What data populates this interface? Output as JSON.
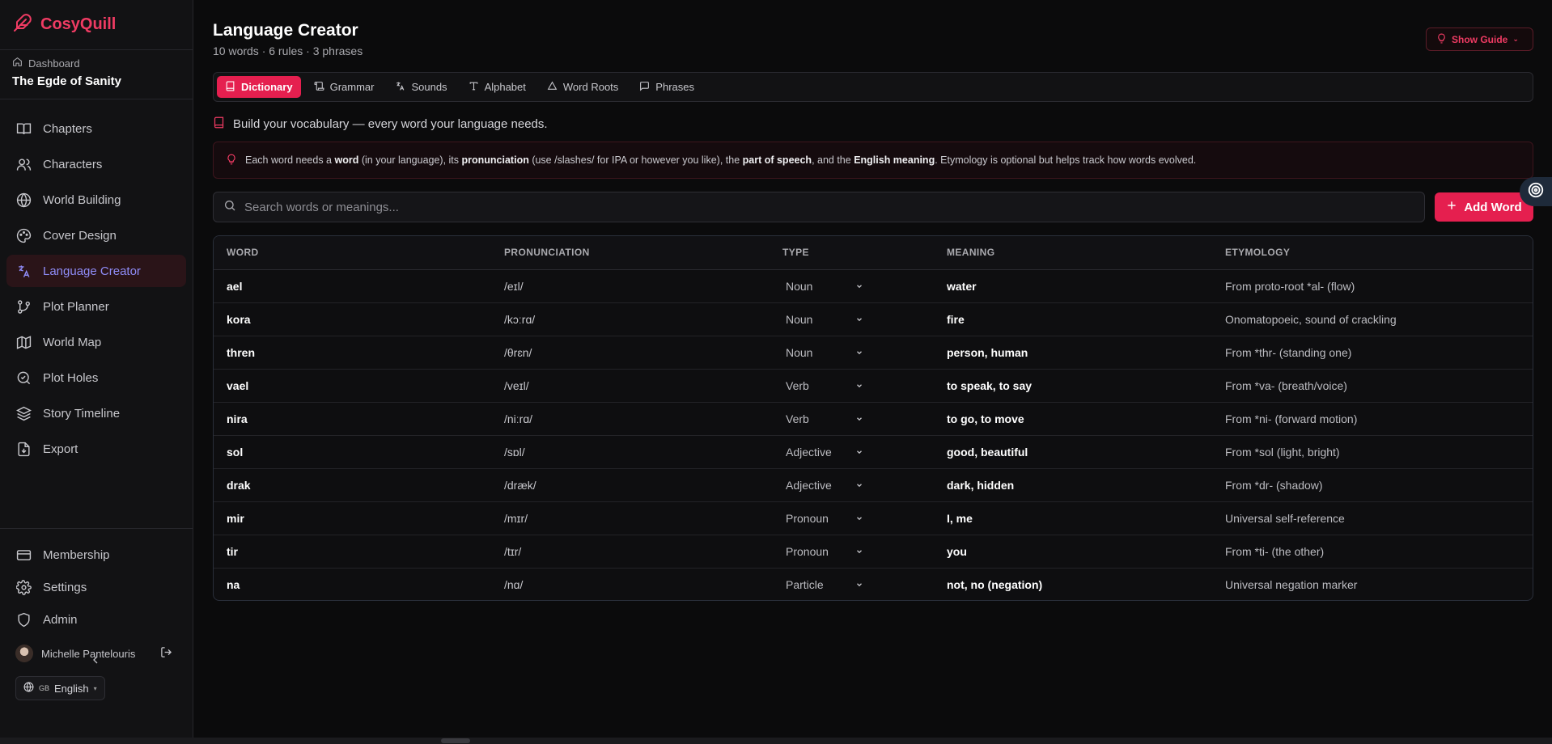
{
  "app": {
    "name": "CosyQuill",
    "accent": "#ef3b63"
  },
  "sidebar": {
    "dashboard_label": "Dashboard",
    "project_title": "The Egde of Sanity",
    "items": [
      {
        "label": "Chapters",
        "icon": "book-open-icon"
      },
      {
        "label": "Characters",
        "icon": "users-icon"
      },
      {
        "label": "World Building",
        "icon": "globe-icon"
      },
      {
        "label": "Cover Design",
        "icon": "palette-icon"
      },
      {
        "label": "Language Creator",
        "icon": "languages-icon",
        "active": true
      },
      {
        "label": "Plot Planner",
        "icon": "git-branch-icon"
      },
      {
        "label": "World Map",
        "icon": "map-icon"
      },
      {
        "label": "Plot Holes",
        "icon": "check-circle-icon"
      },
      {
        "label": "Story Timeline",
        "icon": "layers-icon"
      },
      {
        "label": "Export",
        "icon": "file-download-icon"
      }
    ],
    "bottom_items": [
      {
        "label": "Membership",
        "icon": "credit-card-icon"
      },
      {
        "label": "Settings",
        "icon": "gear-icon"
      },
      {
        "label": "Admin",
        "icon": "shield-icon"
      }
    ],
    "user_name": "Michelle Pantelouris",
    "language_flag": "GB",
    "language_label": "English"
  },
  "header": {
    "title": "Language Creator",
    "subtitle": "10 words · 6 rules · 3 phrases",
    "guide_button": "Show Guide"
  },
  "tabs": [
    {
      "label": "Dictionary",
      "icon": "book-icon",
      "active": true
    },
    {
      "label": "Grammar",
      "icon": "scroll-icon"
    },
    {
      "label": "Sounds",
      "icon": "translate-icon"
    },
    {
      "label": "Alphabet",
      "icon": "type-icon"
    },
    {
      "label": "Word Roots",
      "icon": "triangle-icon"
    },
    {
      "label": "Phrases",
      "icon": "message-square-icon"
    }
  ],
  "intro_text": "Build your vocabulary — every word your language needs.",
  "tip": {
    "t1": "Each word needs a ",
    "b1": "word",
    "t2": " (in your language), its ",
    "b2": "pronunciation",
    "t3": " (use /slashes/ for IPA or however you like), the ",
    "b3": "part of speech",
    "t4": ", and the ",
    "b4": "English meaning",
    "t5": ". Etymology is optional but helps track how words evolved."
  },
  "search": {
    "placeholder": "Search words or meanings...",
    "value": ""
  },
  "add_button": "Add Word",
  "table": {
    "headers": [
      "WORD",
      "PRONUNCIATION",
      "TYPE",
      "MEANING",
      "ETYMOLOGY"
    ],
    "rows": [
      {
        "word": "ael",
        "pron": "/eɪl/",
        "type": "Noun",
        "meaning": "water",
        "etym": "From proto-root *al- (flow)"
      },
      {
        "word": "kora",
        "pron": "/kɔːrɑ/",
        "type": "Noun",
        "meaning": "fire",
        "etym": "Onomatopoeic, sound of crackling"
      },
      {
        "word": "thren",
        "pron": "/θrɛn/",
        "type": "Noun",
        "meaning": "person, human",
        "etym": "From *thr- (standing one)"
      },
      {
        "word": "vael",
        "pron": "/veɪl/",
        "type": "Verb",
        "meaning": "to speak, to say",
        "etym": "From *va- (breath/voice)"
      },
      {
        "word": "nira",
        "pron": "/niːrɑ/",
        "type": "Verb",
        "meaning": "to go, to move",
        "etym": "From *ni- (forward motion)"
      },
      {
        "word": "sol",
        "pron": "/sɒl/",
        "type": "Adjective",
        "meaning": "good, beautiful",
        "etym": "From *sol (light, bright)"
      },
      {
        "word": "drak",
        "pron": "/dræk/",
        "type": "Adjective",
        "meaning": "dark, hidden",
        "etym": "From *dr- (shadow)"
      },
      {
        "word": "mir",
        "pron": "/mɪr/",
        "type": "Pronoun",
        "meaning": "I, me",
        "etym": "Universal self-reference"
      },
      {
        "word": "tir",
        "pron": "/tɪr/",
        "type": "Pronoun",
        "meaning": "you",
        "etym": "From *ti- (the other)"
      },
      {
        "word": "na",
        "pron": "/nɑ/",
        "type": "Particle",
        "meaning": "not, no (negation)",
        "etym": "Universal negation marker"
      }
    ]
  }
}
